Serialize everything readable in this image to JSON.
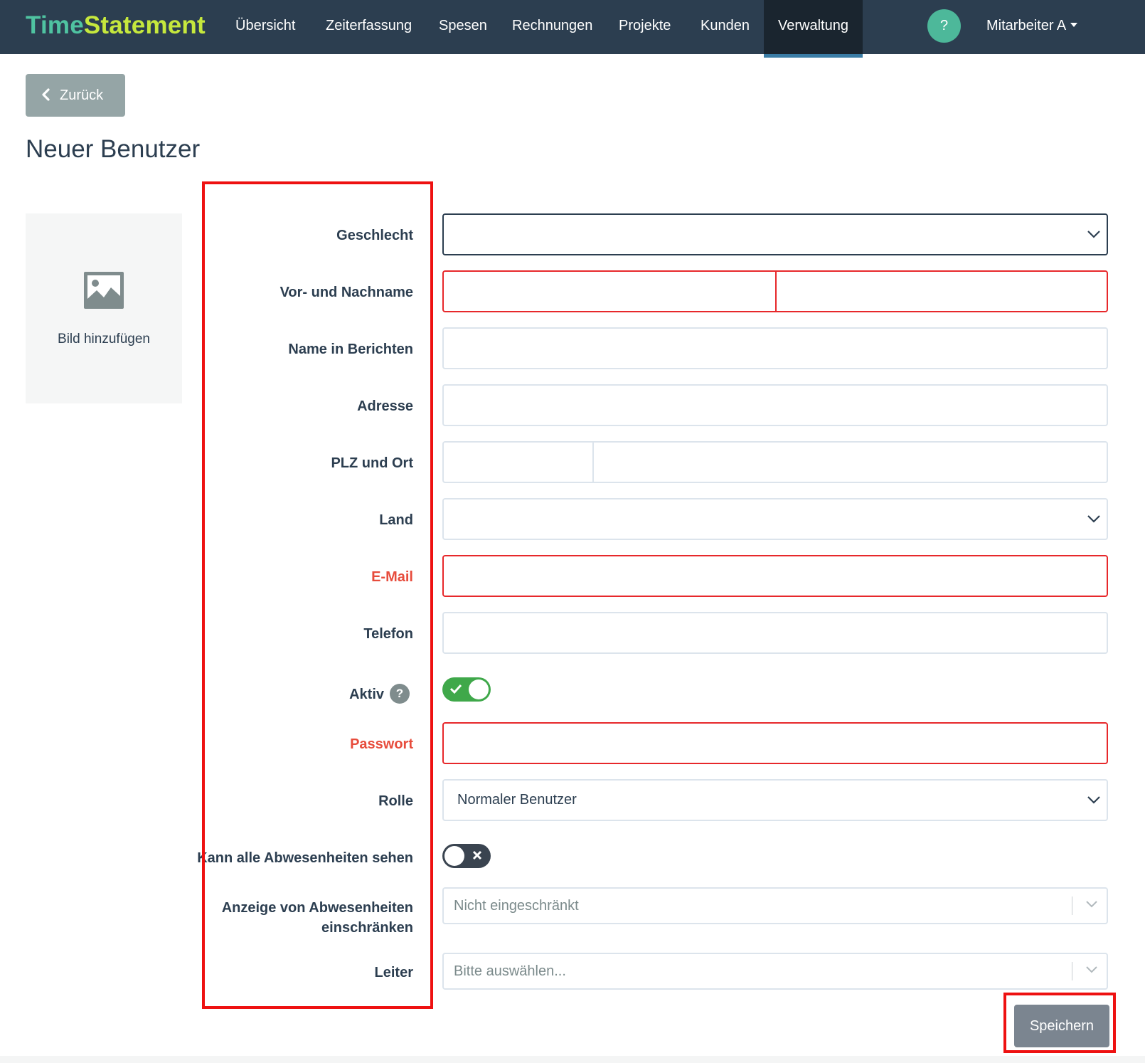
{
  "brand": {
    "part1": "Time",
    "part2": "Statement"
  },
  "nav": {
    "items": [
      {
        "label": "Übersicht"
      },
      {
        "label": "Zeiterfassung"
      },
      {
        "label": "Spesen"
      },
      {
        "label": "Rechnungen"
      },
      {
        "label": "Projekte"
      },
      {
        "label": "Kunden"
      },
      {
        "label": "Verwaltung",
        "active": true
      }
    ],
    "help_label": "?",
    "user_label": "Mitarbeiter A"
  },
  "back_button": {
    "label": "Zurück",
    "icon": "chevron-left-icon"
  },
  "page_title": "Neuer Benutzer",
  "image_upload": {
    "icon": "image-placeholder-icon",
    "label": "Bild hinzufügen"
  },
  "form": {
    "geschlecht": {
      "label": "Geschlecht",
      "value": ""
    },
    "name": {
      "label": "Vor- und Nachname",
      "first": "",
      "last": "",
      "state": "error"
    },
    "report_name": {
      "label": "Name in Berichten",
      "value": ""
    },
    "adresse": {
      "label": "Adresse",
      "value": ""
    },
    "plz_ort": {
      "label": "PLZ und Ort",
      "plz": "",
      "ort": ""
    },
    "land": {
      "label": "Land",
      "value": ""
    },
    "email": {
      "label": "E-Mail",
      "value": "",
      "state": "error"
    },
    "telefon": {
      "label": "Telefon",
      "value": ""
    },
    "aktiv": {
      "label": "Aktiv",
      "help": "?",
      "on": true
    },
    "passwort": {
      "label": "Passwort",
      "value": "",
      "state": "error"
    },
    "rolle": {
      "label": "Rolle",
      "value": "Normaler Benutzer"
    },
    "abwesenheiten_sehen": {
      "label": "Kann alle Abwesenheiten sehen",
      "on": false
    },
    "abwesenheiten_einschraenken": {
      "label_line1": "Anzeige von Abwesenheiten",
      "label_line2": "einschränken",
      "placeholder": "Nicht eingeschränkt"
    },
    "leiter": {
      "label": "Leiter",
      "placeholder": "Bitte auswählen..."
    }
  },
  "save_button": {
    "label": "Speichern"
  },
  "colors": {
    "navbar": "#2c3e50",
    "brand_time": "#4fc3a1",
    "brand_statement": "#c6e83d",
    "error": "#e74c3c",
    "toggle_on": "#3fa84a",
    "annotation": "#ee1111"
  }
}
